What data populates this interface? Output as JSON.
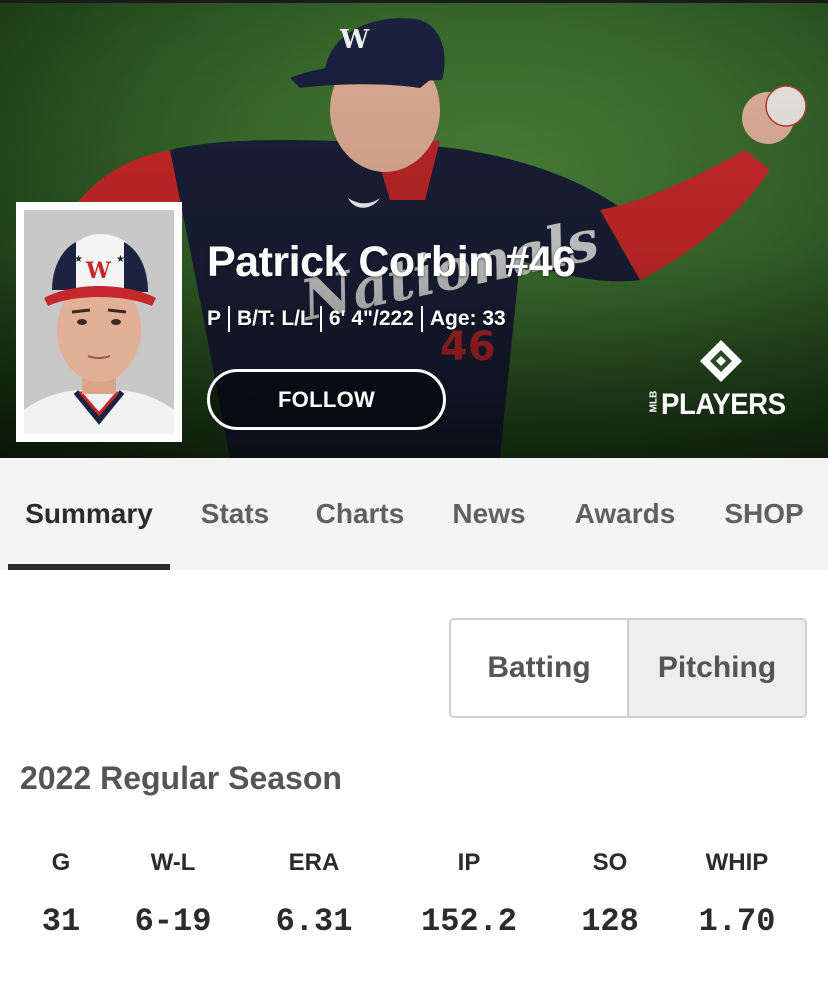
{
  "player": {
    "name": "Patrick Corbin #46",
    "position": "P",
    "bats_throws": "B/T: L/L",
    "height_weight": "6' 4\"/222",
    "age": "Age: 33",
    "follow_label": "FOLLOW"
  },
  "brand": {
    "mlb_text": "MLB",
    "players_text": "PLAYERS"
  },
  "tabs": [
    {
      "label": "Summary",
      "active": true
    },
    {
      "label": "Stats"
    },
    {
      "label": "Charts"
    },
    {
      "label": "News"
    },
    {
      "label": "Awards"
    },
    {
      "label": "SHOP"
    }
  ],
  "toggle": {
    "options": [
      "Batting",
      "Pitching"
    ],
    "selected": "Pitching"
  },
  "season": {
    "title": "2022 Regular Season",
    "headers": [
      "G",
      "W-L",
      "ERA",
      "IP",
      "SO",
      "WHIP"
    ],
    "values": [
      "31",
      "6-19",
      "6.31",
      "152.2",
      "128",
      "1.70"
    ]
  },
  "colors": {
    "navy": "#1c2340",
    "red": "#d0202e",
    "field": "#3c6f2e",
    "tab_bg": "#f4f4f4"
  }
}
